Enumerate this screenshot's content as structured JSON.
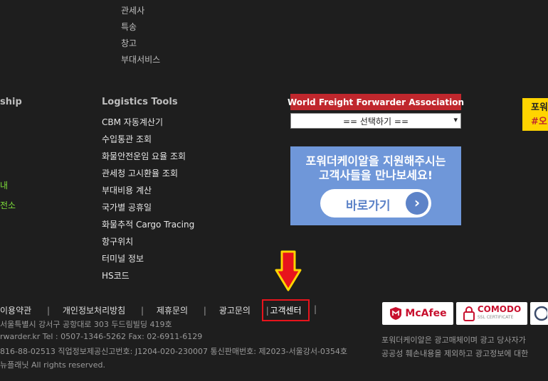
{
  "top_links": [
    "관세사",
    "특송",
    "창고",
    "부대서비스"
  ],
  "columns": {
    "left_partial_heading": "ship",
    "logistics_tools_heading": "Logistics Tools"
  },
  "logistics_tools": [
    "CBM 자동계산기",
    "수입통관 조회",
    "화물안전운임 요율 조회",
    "관세청 고시환율 조회",
    "부대비용 계산",
    "국가별 공휴일",
    "화물추적 Cargo Tracing",
    "항구위치",
    "터미널 정보",
    "HS코드"
  ],
  "left_partial_links": [
    "내",
    "전소"
  ],
  "association": {
    "title": "World Freight Forwarder Association",
    "select_value": "== 선택하기 =="
  },
  "banner": {
    "line1": "포워더케이알을 지원해주시는",
    "line2": "고객사들을 만나보세요!",
    "button": "바로가기"
  },
  "yellow_box": {
    "line1": "포워",
    "line2": "#오"
  },
  "footer_nav": {
    "terms": "이용약관",
    "privacy": "개인정보처리방침",
    "partnership": "제휴문의",
    "ads": "광고문의",
    "customer_center": "고객센터",
    "separator": "|"
  },
  "company_info": {
    "address": "서울특별시 강서구 공항대로 303 두드림빌딩 419호",
    "contact": "rwarder.kr   Tel : 0507-1346-5262   Fax: 02-6911-6129",
    "registration": "816-88-02513   직업정보제공신고번호: J1204-020-230007  통신판매번호: 제2023-서울강서-0354호",
    "copyright": "뉴플래닛 All rights reserved."
  },
  "badges": {
    "mcafee": "McAfee",
    "comodo": "COMODO",
    "comodo_sub": "SSL CERTIFICATE"
  },
  "disclaimer": {
    "line1": "포워더케이알은 광고매체이며 광고 당사자가",
    "line2": "공공성 훼손내용을 제외하고 광고정보에 대한"
  },
  "colors": {
    "background": "#1e1e1e",
    "association_red": "#c0272d",
    "banner_blue": "#6f97d9",
    "highlight_red": "#e8141c",
    "arrow_yellow": "#ffd400",
    "link_green": "#7ddc3a"
  }
}
